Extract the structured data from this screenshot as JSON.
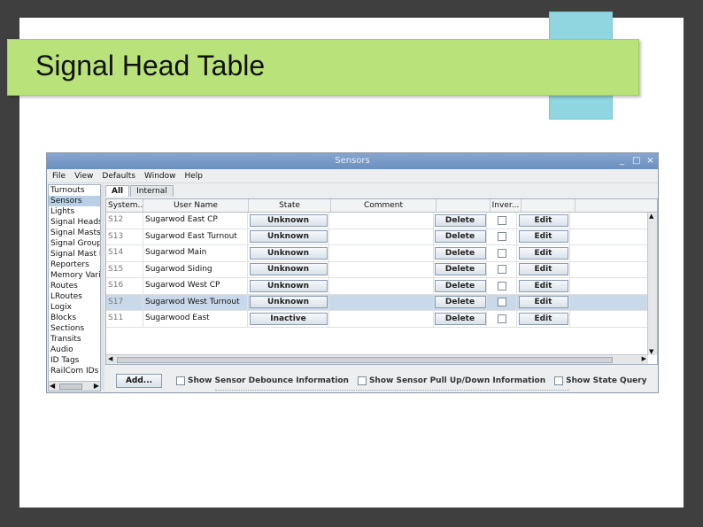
{
  "slide": {
    "title": "Signal Head Table"
  },
  "window": {
    "title": "Sensors",
    "controls": {
      "minimize": "_",
      "maximize": "□",
      "close": "×"
    },
    "menu": [
      "File",
      "View",
      "Defaults",
      "Window",
      "Help"
    ],
    "sidebar": {
      "items": [
        "Turnouts",
        "Sensors",
        "Lights",
        "Signal Heads",
        "Signal Masts",
        "Signal Groups",
        "Signal Mast Logic",
        "Reporters",
        "Memory Variables",
        "Routes",
        "LRoutes",
        "Logix",
        "Blocks",
        "Sections",
        "Transits",
        "Audio",
        "ID Tags",
        "RailCom IDs"
      ],
      "selected": "Sensors"
    },
    "tabs": [
      "All",
      "Internal"
    ],
    "table": {
      "headers": {
        "system": "System...",
        "user_name": "User Name",
        "state": "State",
        "comment": "Comment",
        "delete": "",
        "inverted": "Inver...",
        "edit": ""
      },
      "rows": [
        {
          "system": "S12",
          "user_name": "Sugarwod East CP",
          "state": "Unknown",
          "comment": "",
          "delete": "Delete",
          "edit": "Edit"
        },
        {
          "system": "S13",
          "user_name": "Sugarwod East Turnout",
          "state": "Unknown",
          "comment": "",
          "delete": "Delete",
          "edit": "Edit"
        },
        {
          "system": "S14",
          "user_name": "Sugarwod Main",
          "state": "Unknown",
          "comment": "",
          "delete": "Delete",
          "edit": "Edit"
        },
        {
          "system": "S15",
          "user_name": "Sugarwod Siding",
          "state": "Unknown",
          "comment": "",
          "delete": "Delete",
          "edit": "Edit"
        },
        {
          "system": "S16",
          "user_name": "Sugarwod West CP",
          "state": "Unknown",
          "comment": "",
          "delete": "Delete",
          "edit": "Edit"
        },
        {
          "system": "S17",
          "user_name": "Sugarwod West Turnout",
          "state": "Unknown",
          "comment": "",
          "delete": "Delete",
          "edit": "Edit"
        },
        {
          "system": "S11",
          "user_name": "Sugarwood East",
          "state": "Inactive",
          "comment": "",
          "delete": "Delete",
          "edit": "Edit"
        }
      ],
      "selected_row": 5
    },
    "bottom": {
      "add_label": "Add...",
      "options": [
        "Show Sensor Debounce Information",
        "Show Sensor Pull Up/Down Information",
        "Show State Query"
      ]
    }
  },
  "colors": {
    "title_bar": "#b9e27a",
    "accent_block": "#8fd6e0",
    "window_title": "#6b8fbf",
    "selection": "#b8cfe5"
  }
}
